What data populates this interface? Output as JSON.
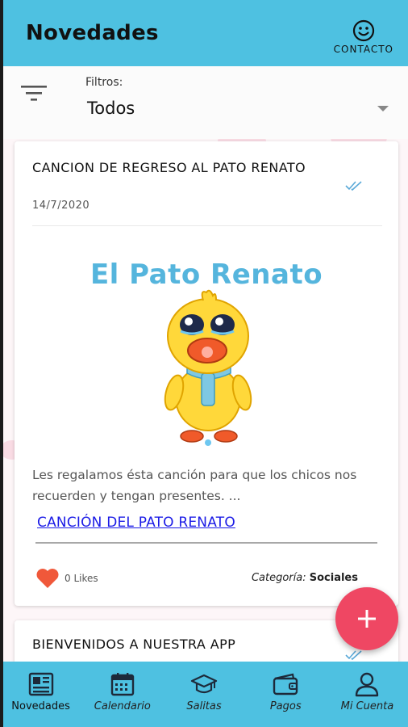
{
  "app_bar": {
    "title": "Novedades",
    "contact_label": "CONTACTO",
    "contact_icon": "smiley-face-icon"
  },
  "filters": {
    "label": "Filtros:",
    "selected": "Todos",
    "icon": "filter-icon"
  },
  "cards": [
    {
      "title": "CANCION DE REGRESO AL PATO RENATO",
      "date": "14/7/2020",
      "image_title": "El Pato Renato",
      "description": "Les regalamos ésta canción para que los chicos nos recuerden y tengan presentes. ...",
      "link_text": "CANCIÓN DEL PATO RENATO",
      "likes": "0 Likes",
      "category_label": "Categoría:",
      "category_value": "Sociales"
    },
    {
      "title": "BIENVENIDOS A NUESTRA APP"
    }
  ],
  "fab": {
    "icon": "plus-icon"
  },
  "bottom_nav": {
    "items": [
      {
        "label": "Novedades",
        "icon": "newspaper-icon",
        "active": true
      },
      {
        "label": "Calendario",
        "icon": "calendar-icon",
        "active": false
      },
      {
        "label": "Salitas",
        "icon": "graduation-cap-icon",
        "active": false
      },
      {
        "label": "Pagos",
        "icon": "wallet-icon",
        "active": false
      },
      {
        "label": "Mi Cuenta",
        "icon": "user-icon",
        "active": false
      }
    ]
  },
  "colors": {
    "primary": "#4ec1e1",
    "fab": "#ef4763",
    "link": "#1a1ae6",
    "heart": "#f0583a"
  }
}
